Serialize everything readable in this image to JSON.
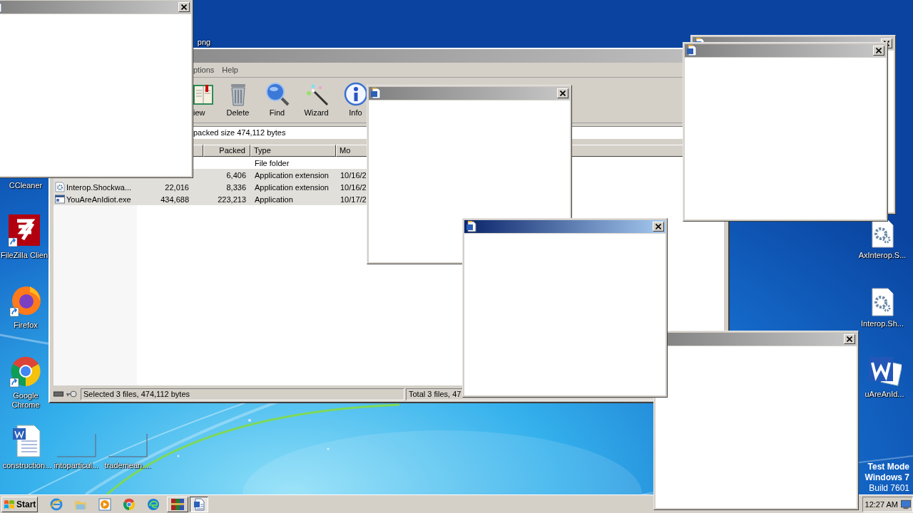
{
  "desktop_icons": [
    {
      "label": "png",
      "kind": "none"
    },
    {
      "label": "CCleaner",
      "kind": "none"
    },
    {
      "label": "FileZilla Clien",
      "kind": "filezilla"
    },
    {
      "label": "Firefox",
      "kind": "firefox"
    },
    {
      "label": "Google Chrome",
      "kind": "chrome"
    },
    {
      "label": "construction...",
      "kind": "word-doc"
    },
    {
      "label": "intoparticul...",
      "kind": "blank"
    },
    {
      "label": "trademean....",
      "kind": "blank"
    },
    {
      "label": "AxInterop.S...",
      "kind": "gear-doc"
    },
    {
      "label": "Interop.Sh...",
      "kind": "gear-doc"
    },
    {
      "label": "uAreAnId...",
      "kind": "word"
    }
  ],
  "test_mode": [
    {
      "text": "Test Mode",
      "bold": true
    },
    {
      "text": "Windows 7",
      "bold": true
    },
    {
      "text": "Build 7601",
      "bold": false
    }
  ],
  "archive_window": {
    "menu": [
      "ptions",
      "Help"
    ],
    "toolbar": [
      {
        "label": "iew",
        "kind": "view"
      },
      {
        "label": "Delete",
        "kind": "delete"
      },
      {
        "label": "Find",
        "kind": "find"
      },
      {
        "label": "Wizard",
        "kind": "wizard"
      },
      {
        "label": "Info",
        "kind": "info"
      }
    ],
    "address": "packed size 474,112 bytes",
    "columns": [
      "Packed",
      "Type",
      "Mo"
    ],
    "rows": [
      {
        "type": "File folder",
        "selected": false
      },
      {
        "packed": "6,406",
        "type": "Application extension",
        "modified": "10/16/2",
        "selected": true
      },
      {
        "name": "Interop.Shockwa...",
        "kind": "library",
        "size": "22,016",
        "packed": "8,336",
        "type": "Application extension",
        "modified": "10/16/2",
        "selected": true
      },
      {
        "name": "YouAreAnIdiot.exe",
        "kind": "program",
        "size": "434,688",
        "packed": "223,213",
        "type": "Application",
        "modified": "10/17/2",
        "selected": true
      }
    ],
    "status": [
      "Selected 3 files, 474,112 bytes",
      "Total 3 files, 47"
    ]
  },
  "popups": [
    {
      "active": false
    },
    {
      "active": false
    },
    {
      "active": false
    },
    {
      "active": false
    },
    {
      "active": true
    },
    {
      "active": false
    }
  ],
  "taskbar": {
    "start": "Start",
    "quick_launch": [
      {
        "kind": "ie"
      },
      {
        "kind": "folder"
      },
      {
        "kind": "media"
      },
      {
        "kind": "chrome"
      },
      {
        "kind": "edge"
      }
    ],
    "tasks": [
      {
        "kind": "archive",
        "selected": false
      },
      {
        "kind": "word",
        "selected": true
      }
    ],
    "clock": "12:27 AM"
  }
}
